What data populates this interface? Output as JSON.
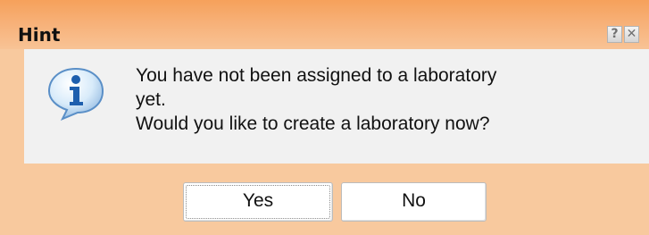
{
  "dialog": {
    "title": "Hint",
    "help_label": "?",
    "close_label": "✕",
    "icon": "info-icon",
    "message": {
      "line1": "You have not been assigned to a laboratory",
      "line2": "yet.",
      "line3": "Would you like to create a laboratory now?"
    },
    "buttons": {
      "yes_label": "Yes",
      "no_label": "No"
    }
  },
  "colors": {
    "titlebar": "#f6a15b",
    "dialog_background": "#f8c99e",
    "content_background": "#f1f1f1",
    "button_background": "#ffffff"
  }
}
